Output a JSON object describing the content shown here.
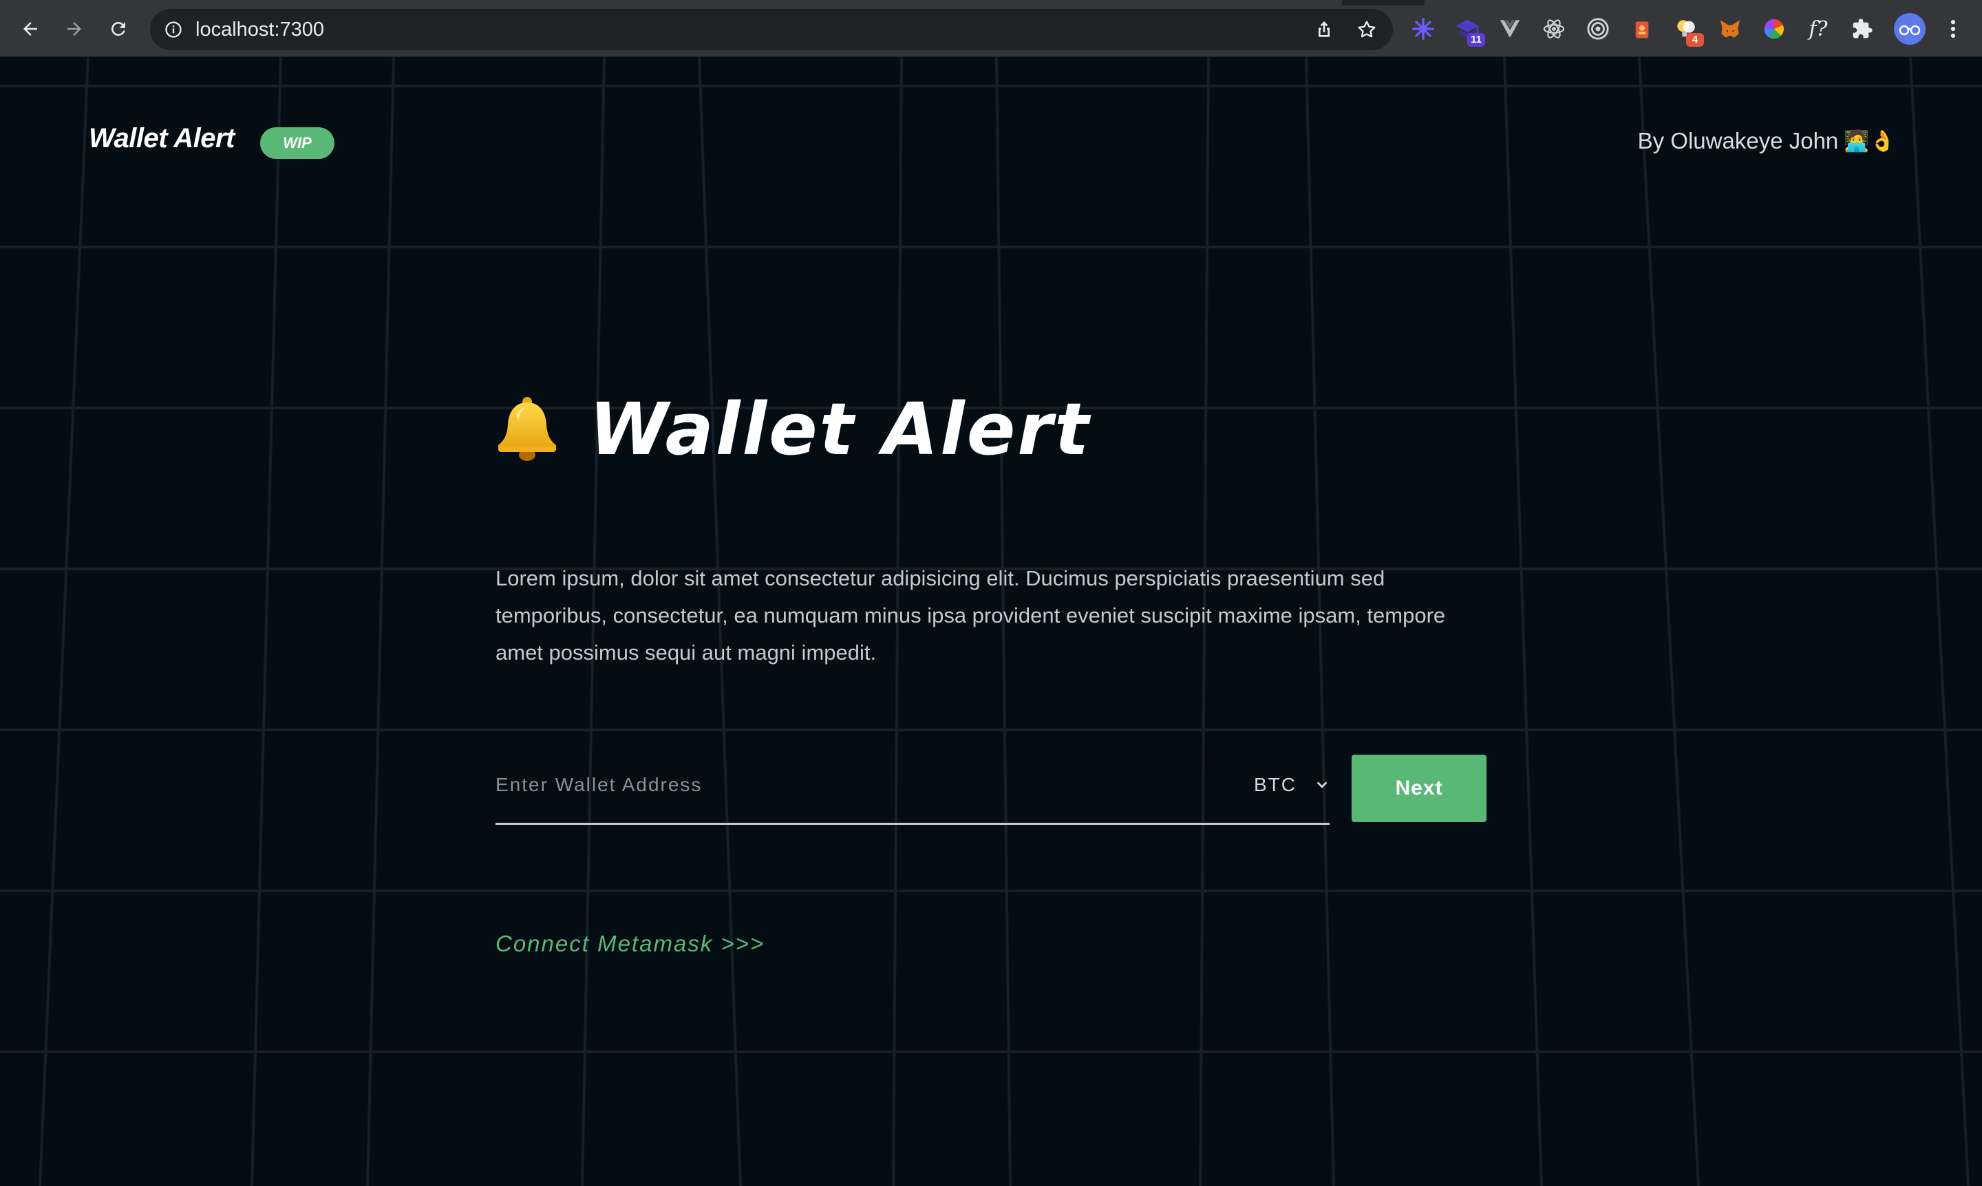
{
  "browser": {
    "url": "localhost:7300",
    "extension_badges": {
      "graduation": "11",
      "bulb": "4"
    }
  },
  "header": {
    "brand": "Wallet Alert",
    "badge": "WIP",
    "author": "By Oluwakeye John",
    "author_emoji": "🧑‍💻👌"
  },
  "hero": {
    "icon": "bell-icon",
    "title": "Wallet Alert",
    "description": "Lorem ipsum, dolor sit amet consectetur adipisicing elit. Ducimus perspiciatis praesentium sed temporibus, consectetur, ea numquam minus ipsa provident eveniet suscipit maxime ipsam, tempore amet possimus sequi aut magni impedit."
  },
  "form": {
    "wallet_placeholder": "Enter Wallet Address",
    "wallet_value": "",
    "currency_selected": "BTC",
    "next_label": "Next"
  },
  "links": {
    "metamask": "Connect Metamask >>>"
  },
  "colors": {
    "accent": "#5ab877",
    "background": "#050d14",
    "grid": "#1a2530"
  }
}
